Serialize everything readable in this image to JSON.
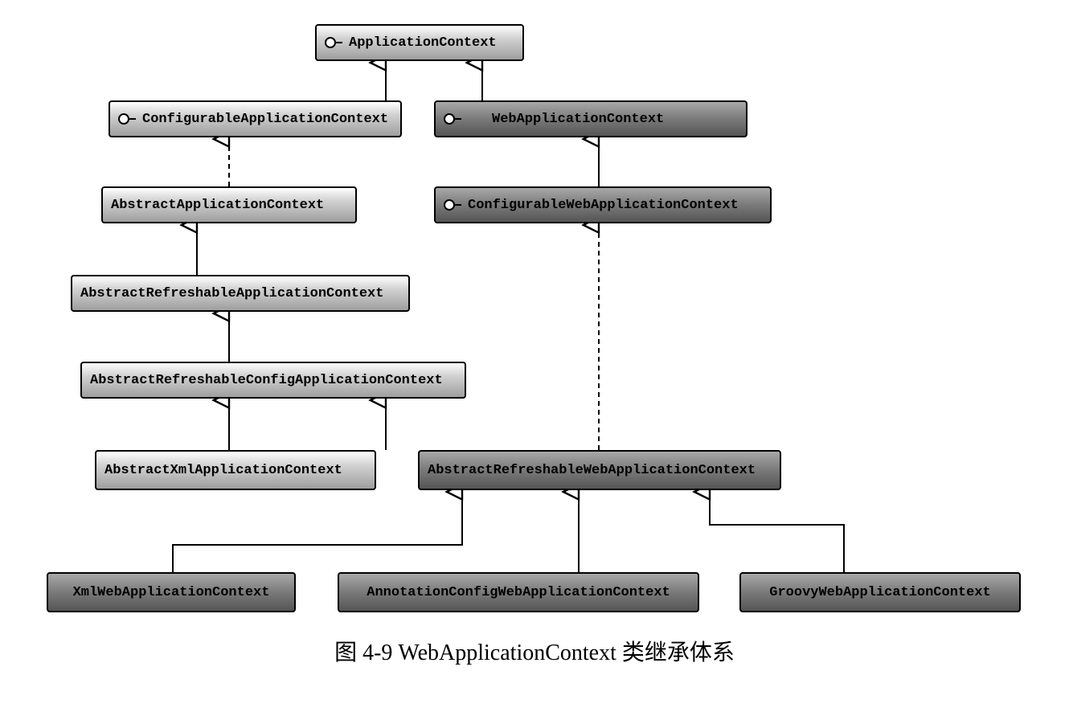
{
  "nodes": {
    "applicationContext": {
      "label": "ApplicationContext",
      "interface": true
    },
    "configurableApplicationContext": {
      "label": "ConfigurableApplicationContext",
      "interface": true
    },
    "webApplicationContext": {
      "label": "WebApplicationContext",
      "interface": true
    },
    "abstractApplicationContext": {
      "label": "AbstractApplicationContext",
      "interface": false
    },
    "configurableWebApplicationContext": {
      "label": "ConfigurableWebApplicationContext",
      "interface": true
    },
    "abstractRefreshableApplicationContext": {
      "label": "AbstractRefreshableApplicationContext",
      "interface": false
    },
    "abstractRefreshableConfigApplicationContext": {
      "label": "AbstractRefreshableConfigApplicationContext",
      "interface": false
    },
    "abstractXmlApplicationContext": {
      "label": "AbstractXmlApplicationContext",
      "interface": false
    },
    "abstractRefreshableWebApplicationContext": {
      "label": "AbstractRefreshableWebApplicationContext",
      "interface": false
    },
    "xmlWebApplicationContext": {
      "label": "XmlWebApplicationContext",
      "interface": false
    },
    "annotationConfigWebApplicationContext": {
      "label": "AnnotationConfigWebApplicationContext",
      "interface": false
    },
    "groovyWebApplicationContext": {
      "label": "GroovyWebApplicationContext",
      "interface": false
    }
  },
  "edges": [
    {
      "from": "configurableApplicationContext",
      "to": "applicationContext",
      "dashed": false
    },
    {
      "from": "webApplicationContext",
      "to": "applicationContext",
      "dashed": false
    },
    {
      "from": "abstractApplicationContext",
      "to": "configurableApplicationContext",
      "dashed": true
    },
    {
      "from": "configurableWebApplicationContext",
      "to": "webApplicationContext",
      "dashed": false
    },
    {
      "from": "abstractRefreshableApplicationContext",
      "to": "abstractApplicationContext",
      "dashed": false
    },
    {
      "from": "abstractRefreshableConfigApplicationContext",
      "to": "abstractRefreshableApplicationContext",
      "dashed": false
    },
    {
      "from": "abstractXmlApplicationContext",
      "to": "abstractRefreshableConfigApplicationContext",
      "dashed": false
    },
    {
      "from": "abstractRefreshableWebApplicationContext",
      "to": "abstractRefreshableConfigApplicationContext",
      "dashed": false
    },
    {
      "from": "abstractRefreshableWebApplicationContext",
      "to": "configurableWebApplicationContext",
      "dashed": true
    },
    {
      "from": "xmlWebApplicationContext",
      "to": "abstractRefreshableWebApplicationContext",
      "dashed": false
    },
    {
      "from": "annotationConfigWebApplicationContext",
      "to": "abstractRefreshableWebApplicationContext",
      "dashed": false
    },
    {
      "from": "groovyWebApplicationContext",
      "to": "abstractRefreshableWebApplicationContext",
      "dashed": false
    }
  ],
  "caption": "图 4-9    WebApplicationContext 类继承体系"
}
